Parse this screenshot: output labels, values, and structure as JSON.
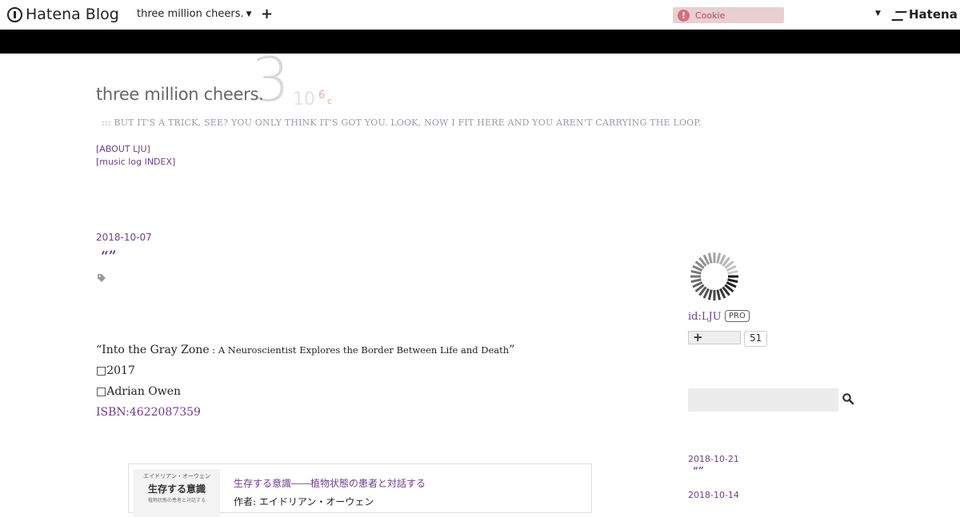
{
  "globalbar": {
    "logo_text": "Hatena Blog",
    "blog_selector": "three million cheers.",
    "add_label": "+",
    "cookie_label": "Cookie",
    "brand_right": "Hatena"
  },
  "header": {
    "title": "three million cheers.",
    "deco_three": "3",
    "deco_ten": "10",
    "deco_six": "6",
    "deco_c": "c",
    "tagline": "::: BUT IT'S A TRICK, SEE? YOU ONLY THINK IT'S GOT YOU. LOOK, NOW I FIT HERE AND YOU AREN'T CARRYING THE LOOP.",
    "links": [
      "[ABOUT LJU]",
      "[music log INDEX]"
    ]
  },
  "entry": {
    "date": "2018-10-07",
    "title": "“”",
    "book_title_open": "“Into the Gray Zone",
    "book_subtitle": " : A Neuroscientist Explores the Border Between Life and Death",
    "book_title_close": "”",
    "year_line": "2017",
    "author_line": "Adrian Owen",
    "isbn": "ISBN:4622087359",
    "card": {
      "thumb_small": "エイドリアン・オーウェン",
      "thumb_title": "生存する意識",
      "thumb_sub": "植物状態の患者と対話する",
      "title": "生存する意識――植物状態の患者と対話する",
      "author": "作者: エイドリアン・オーウェン"
    }
  },
  "sidebar": {
    "user_id": "id:LJU",
    "pro_badge": "PRO",
    "reader_plus": "+",
    "reader_count": "51",
    "search_placeholder": "",
    "recent": [
      {
        "date": "2018-10-21",
        "title": "“”"
      },
      {
        "date": "2018-10-14",
        "title": ""
      }
    ]
  },
  "colors": {
    "link": "#6b3f8f",
    "topbar_black": "#000000",
    "cookie_bg": "#e8cfd2"
  }
}
